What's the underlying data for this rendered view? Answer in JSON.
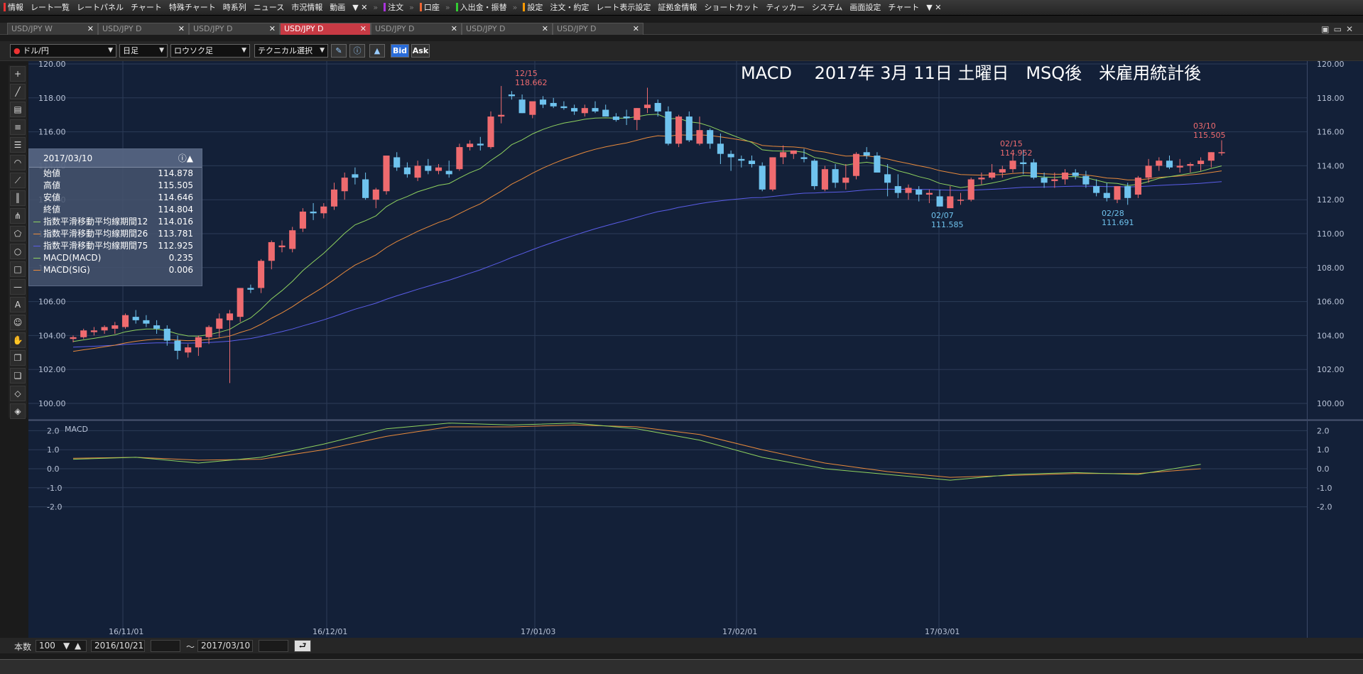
{
  "menu": {
    "items": [
      "情報",
      "レート一覧",
      "レートパネル",
      "チャート",
      "特殊チャート",
      "時系列",
      "ニュース",
      "市況情報",
      "動画",
      "注文",
      "口座",
      "入出金・振替",
      "設定",
      "注文・約定",
      "レート表示設定",
      "証拠金情報",
      "ショートカット",
      "ティッカー",
      "システム",
      "画面設定",
      "チャート"
    ]
  },
  "tabs": [
    {
      "label": "USD/JPY W",
      "active": false
    },
    {
      "label": "USD/JPY D",
      "active": false
    },
    {
      "label": "USD/JPY D",
      "active": false
    },
    {
      "label": "USD/JPY D",
      "active": true
    },
    {
      "label": "USD/JPY D",
      "active": false
    },
    {
      "label": "USD/JPY D",
      "active": false
    },
    {
      "label": "USD/JPY D",
      "active": false
    }
  ],
  "toolbar": {
    "pair": "ドル/円",
    "period": "日足",
    "style": "ロウソク足",
    "technical": "テクニカル選択",
    "bid": "Bid",
    "ask": "Ask"
  },
  "chart_data": {
    "type": "candlestick",
    "title": "MACD　 2017年 3月 11日 土曜日　MSQ後　米雇用統計後",
    "yticks": [
      "120.00",
      "118.00",
      "116.00",
      "114.00",
      "112.00",
      "110.00",
      "108.00",
      "106.00",
      "104.00",
      "102.00",
      "100.00"
    ],
    "ylim": [
      99.5,
      120.5
    ],
    "macd_yticks": [
      "2.0",
      "1.0",
      "0.0",
      "-1.0",
      "-2.0"
    ],
    "macd_label": "MACD",
    "xticks": [
      "16/11/01",
      "16/12/01",
      "17/01/03",
      "17/02/01",
      "17/03/01"
    ],
    "annotations": [
      {
        "date": "12/15",
        "value": "118.662",
        "color": "up"
      },
      {
        "date": "02/15",
        "value": "114.952",
        "color": "up"
      },
      {
        "date": "03/10",
        "value": "115.505",
        "color": "up"
      },
      {
        "date": "02/07",
        "value": "111.585",
        "color": "down"
      },
      {
        "date": "02/28",
        "value": "111.691",
        "color": "down"
      }
    ],
    "colors": {
      "up": "#ef6b6f",
      "down": "#6fc3ee",
      "ema12": "#8fd25f",
      "ema26": "#e88a3c",
      "ema75": "#5a5de8",
      "macd": "#8fd25f",
      "sig": "#e88a3c",
      "grid": "#2c3b57"
    },
    "candles": [
      [
        103.8,
        104.0,
        103.6,
        103.9
      ],
      [
        103.9,
        104.4,
        103.8,
        104.3
      ],
      [
        104.2,
        104.5,
        104.0,
        104.3
      ],
      [
        104.3,
        104.6,
        104.1,
        104.5
      ],
      [
        104.4,
        104.8,
        104.1,
        104.6
      ],
      [
        104.5,
        105.3,
        104.4,
        105.2
      ],
      [
        105.1,
        105.5,
        104.7,
        104.9
      ],
      [
        104.9,
        105.2,
        104.5,
        104.7
      ],
      [
        104.6,
        104.9,
        104.1,
        104.4
      ],
      [
        104.4,
        104.6,
        103.4,
        103.7
      ],
      [
        103.7,
        104.0,
        102.6,
        103.1
      ],
      [
        103.0,
        103.5,
        102.7,
        103.3
      ],
      [
        103.3,
        104.0,
        102.8,
        103.9
      ],
      [
        103.9,
        104.6,
        103.5,
        104.5
      ],
      [
        104.4,
        105.3,
        103.9,
        105.0
      ],
      [
        104.9,
        105.5,
        101.2,
        105.3
      ],
      [
        105.1,
        106.8,
        104.8,
        106.8
      ],
      [
        106.8,
        107.0,
        106.5,
        106.7
      ],
      [
        106.8,
        108.5,
        106.5,
        108.4
      ],
      [
        108.4,
        109.6,
        107.9,
        109.5
      ],
      [
        109.2,
        109.6,
        108.9,
        109.3
      ],
      [
        109.1,
        110.4,
        108.9,
        110.2
      ],
      [
        110.3,
        111.5,
        110.1,
        111.3
      ],
      [
        111.3,
        111.8,
        110.8,
        111.2
      ],
      [
        111.2,
        111.8,
        110.9,
        111.6
      ],
      [
        111.6,
        113.0,
        111.4,
        112.6
      ],
      [
        112.5,
        113.6,
        112.0,
        113.3
      ],
      [
        113.5,
        113.9,
        112.9,
        113.3
      ],
      [
        113.2,
        113.6,
        112.0,
        112.1
      ],
      [
        112.0,
        112.7,
        111.5,
        112.6
      ],
      [
        112.5,
        114.6,
        112.3,
        114.6
      ],
      [
        114.5,
        114.8,
        113.7,
        113.9
      ],
      [
        113.9,
        114.2,
        113.3,
        113.5
      ],
      [
        113.3,
        114.3,
        113.1,
        114.0
      ],
      [
        114.0,
        114.4,
        113.5,
        113.7
      ],
      [
        113.7,
        114.1,
        113.5,
        113.9
      ],
      [
        113.7,
        114.3,
        113.3,
        113.5
      ],
      [
        113.8,
        115.3,
        113.7,
        115.1
      ],
      [
        115.1,
        115.5,
        114.9,
        115.3
      ],
      [
        115.3,
        115.7,
        114.9,
        115.2
      ],
      [
        115.1,
        117.2,
        115.0,
        116.9
      ],
      [
        116.9,
        118.7,
        116.5,
        117.0
      ],
      [
        118.2,
        118.4,
        117.9,
        118.1
      ],
      [
        117.9,
        118.2,
        117.1,
        117.1
      ],
      [
        117.0,
        117.7,
        116.8,
        117.8
      ],
      [
        117.9,
        118.1,
        117.4,
        117.6
      ],
      [
        117.7,
        118.0,
        117.4,
        117.5
      ],
      [
        117.5,
        117.8,
        117.3,
        117.4
      ],
      [
        117.4,
        117.6,
        117.0,
        117.2
      ],
      [
        117.1,
        117.6,
        116.9,
        117.4
      ],
      [
        117.4,
        117.8,
        117.1,
        117.2
      ],
      [
        117.3,
        117.6,
        117.0,
        116.9
      ],
      [
        116.9,
        117.1,
        116.6,
        116.7
      ],
      [
        116.9,
        117.3,
        116.4,
        116.8
      ],
      [
        116.7,
        117.4,
        116.1,
        117.4
      ],
      [
        117.4,
        118.6,
        117.1,
        117.6
      ],
      [
        117.7,
        117.9,
        116.9,
        117.2
      ],
      [
        117.2,
        117.5,
        115.2,
        115.3
      ],
      [
        115.3,
        117.0,
        115.1,
        116.9
      ],
      [
        116.9,
        117.2,
        115.4,
        115.5
      ],
      [
        115.3,
        116.9,
        115.2,
        116.1
      ],
      [
        116.1,
        116.2,
        115.0,
        115.3
      ],
      [
        115.3,
        115.9,
        114.1,
        114.7
      ],
      [
        114.7,
        114.9,
        113.7,
        114.5
      ],
      [
        114.4,
        114.6,
        113.9,
        114.3
      ],
      [
        114.3,
        114.6,
        113.9,
        114.1
      ],
      [
        114.0,
        114.2,
        112.5,
        112.6
      ],
      [
        112.6,
        114.5,
        112.5,
        114.5
      ],
      [
        114.5,
        115.2,
        114.1,
        114.8
      ],
      [
        114.7,
        114.9,
        114.4,
        114.9
      ],
      [
        114.5,
        115.0,
        114.2,
        114.4
      ],
      [
        114.3,
        114.4,
        112.6,
        112.8
      ],
      [
        112.6,
        114.0,
        112.5,
        113.8
      ],
      [
        113.8,
        114.1,
        112.7,
        113.0
      ],
      [
        113.0,
        114.1,
        112.6,
        113.3
      ],
      [
        113.4,
        114.8,
        113.2,
        114.7
      ],
      [
        114.8,
        115.1,
        114.4,
        114.6
      ],
      [
        114.6,
        114.8,
        113.7,
        113.6
      ],
      [
        113.5,
        114.1,
        112.2,
        113.0
      ],
      [
        112.8,
        113.5,
        112.1,
        112.4
      ],
      [
        112.4,
        112.9,
        112.0,
        112.7
      ],
      [
        112.6,
        112.8,
        111.9,
        112.3
      ],
      [
        112.3,
        112.6,
        111.8,
        112.4
      ],
      [
        112.2,
        112.6,
        111.6,
        111.6
      ],
      [
        111.5,
        112.8,
        111.6,
        112.2
      ],
      [
        112.0,
        112.4,
        111.7,
        112.0
      ],
      [
        112.0,
        113.3,
        111.9,
        113.2
      ],
      [
        113.2,
        113.6,
        112.9,
        113.3
      ],
      [
        113.3,
        114.1,
        113.2,
        113.6
      ],
      [
        113.6,
        114.0,
        113.3,
        113.8
      ],
      [
        113.8,
        114.7,
        113.6,
        114.3
      ],
      [
        114.2,
        114.95,
        113.5,
        114.1
      ],
      [
        114.2,
        114.4,
        113.2,
        113.3
      ],
      [
        113.3,
        113.6,
        112.7,
        113.0
      ],
      [
        113.1,
        113.6,
        112.7,
        113.2
      ],
      [
        113.2,
        113.8,
        112.9,
        113.6
      ],
      [
        113.6,
        113.8,
        113.2,
        113.4
      ],
      [
        113.4,
        113.7,
        112.7,
        112.9
      ],
      [
        112.8,
        113.2,
        112.2,
        112.4
      ],
      [
        112.4,
        113.0,
        111.9,
        112.1
      ],
      [
        112.0,
        112.8,
        111.8,
        112.8
      ],
      [
        112.8,
        113.0,
        111.7,
        112.1
      ],
      [
        112.3,
        113.4,
        112.1,
        113.3
      ],
      [
        113.3,
        114.4,
        113.0,
        114.0
      ],
      [
        114.0,
        114.5,
        113.7,
        114.3
      ],
      [
        114.3,
        114.6,
        113.8,
        113.9
      ],
      [
        113.9,
        114.4,
        113.6,
        114.0
      ],
      [
        114.0,
        114.2,
        113.6,
        114.1
      ],
      [
        114.1,
        114.5,
        113.7,
        114.3
      ],
      [
        114.3,
        114.8,
        113.9,
        114.8
      ],
      [
        114.8,
        115.5,
        114.6,
        114.8
      ]
    ],
    "macd": {
      "x": [
        0,
        6,
        12,
        18,
        24,
        30,
        36,
        42,
        48,
        54,
        60,
        66,
        72,
        78,
        84,
        90,
        96,
        102,
        108
      ],
      "macd": [
        0.5,
        0.6,
        0.3,
        0.6,
        1.3,
        2.1,
        2.4,
        2.3,
        2.4,
        2.1,
        1.5,
        0.6,
        0.0,
        -0.3,
        -0.6,
        -0.3,
        -0.2,
        -0.3,
        0.23
      ],
      "sig": [
        0.55,
        0.6,
        0.45,
        0.5,
        1.0,
        1.7,
        2.2,
        2.2,
        2.3,
        2.2,
        1.8,
        1.0,
        0.3,
        -0.15,
        -0.45,
        -0.35,
        -0.25,
        -0.25,
        0.0
      ]
    }
  },
  "info": {
    "date": "2017/03/10",
    "rows": [
      {
        "label": "始値",
        "value": "114.878",
        "swatch": ""
      },
      {
        "label": "高値",
        "value": "115.505",
        "swatch": ""
      },
      {
        "label": "安値",
        "value": "114.646",
        "swatch": ""
      },
      {
        "label": "終値",
        "value": "114.804",
        "swatch": ""
      },
      {
        "label": "指数平滑移動平均線期間12",
        "value": "114.016",
        "swatch": "#8fd25f"
      },
      {
        "label": "指数平滑移動平均線期間26",
        "value": "113.781",
        "swatch": "#e88a3c"
      },
      {
        "label": "指数平滑移動平均線期間75",
        "value": "112.925",
        "swatch": "#5a5de8"
      },
      {
        "label": "MACD(MACD)",
        "value": "0.235",
        "swatch": "#8fd25f"
      },
      {
        "label": "MACD(SIG)",
        "value": "0.006",
        "swatch": "#e88a3c"
      }
    ]
  },
  "status": {
    "count_label": "本数",
    "count": "100",
    "from": "2016/10/21",
    "tilde": "～",
    "to": "2017/03/10"
  }
}
